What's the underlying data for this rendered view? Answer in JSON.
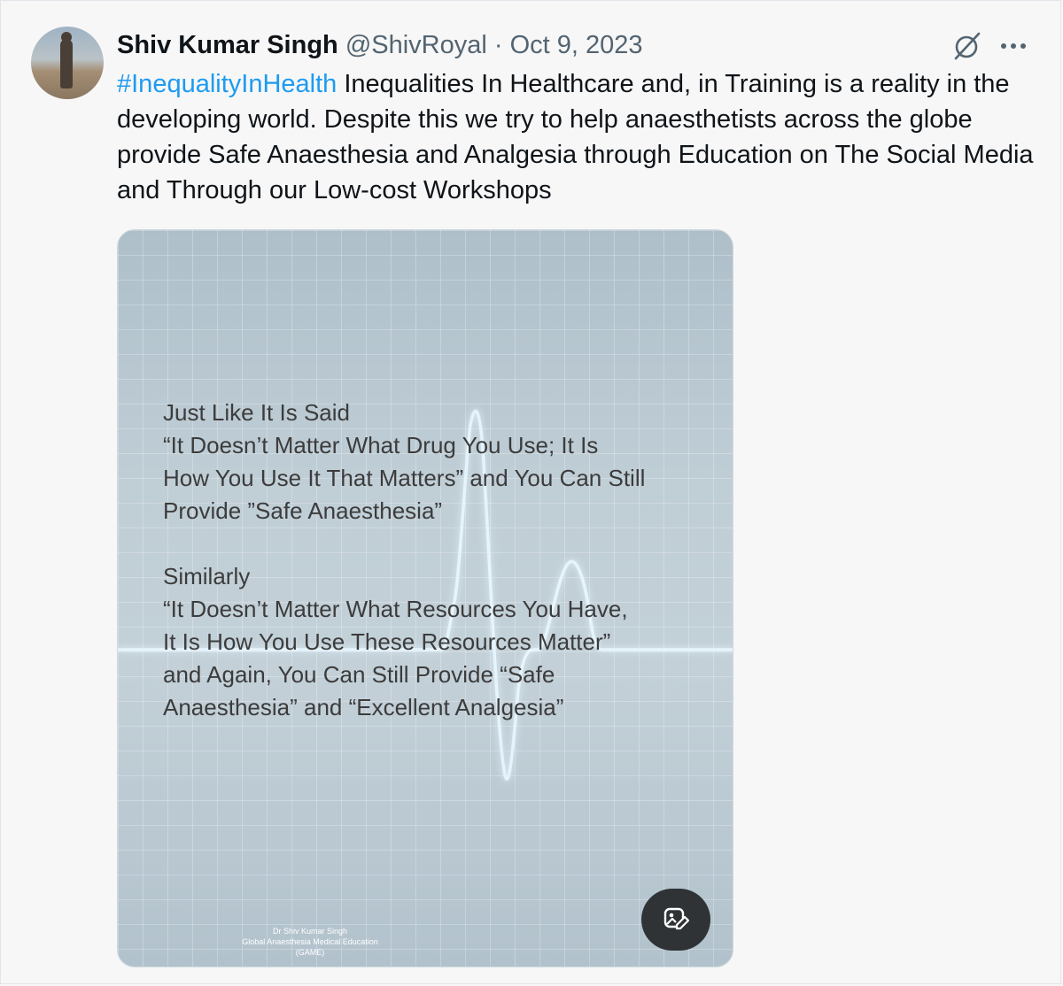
{
  "post": {
    "author_name": "Shiv Kumar Singh",
    "handle": "@ShivRoyal",
    "separator": "·",
    "date": "Oct 9, 2023",
    "hashtag": "#InequalityInHealth",
    "body": " Inequalities In Healthcare and, in Training is a reality in the developing world. Despite this we try to help anaesthetists across the globe provide Safe Anaesthesia and Analgesia through Education on The Social Media and Through our Low-cost Workshops"
  },
  "icons": {
    "grok": "grok-icon",
    "more": "more-icon",
    "alt_edit": "image-edit-icon"
  },
  "media": {
    "paragraph1": [
      "Just Like It Is Said",
      "“It Doesn’t Matter What Drug You Use; It Is",
      "How You Use It That Matters” and You Can Still",
      "Provide ”Safe Anaesthesia”"
    ],
    "paragraph2": [
      "Similarly",
      "“It Doesn’t Matter What Resources You Have,",
      "It Is How You Use These Resources Matter”",
      "and Again, You Can Still Provide “Safe",
      "Anaesthesia” and “Excellent Analgesia”"
    ],
    "credit": [
      "Dr Shiv Kumar Singh",
      "Global Anaesthesia Medical Education",
      "(GAME)"
    ]
  },
  "colors": {
    "hashtag": "#1d9bf0",
    "text": "#0f1419",
    "muted": "#536471",
    "alt_button_bg": "#2f3336"
  }
}
